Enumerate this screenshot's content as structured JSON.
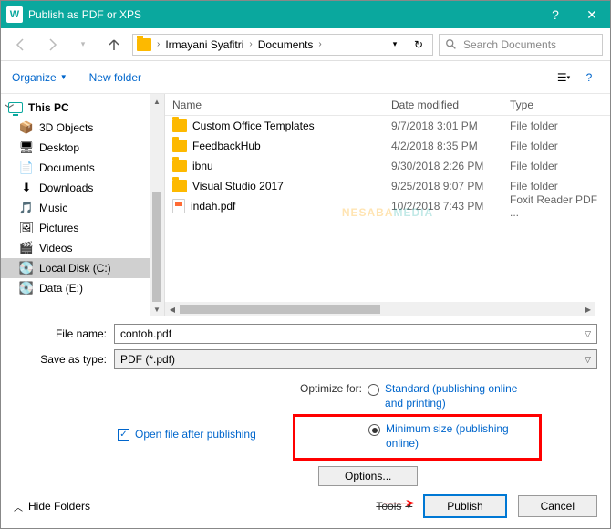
{
  "window": {
    "title": "Publish as PDF or XPS"
  },
  "nav": {
    "breadcrumb": [
      "Irmayani Syafitri",
      "Documents"
    ],
    "search_placeholder": "Search Documents"
  },
  "toolbar": {
    "organize": "Organize",
    "new_folder": "New folder"
  },
  "sidebar": {
    "root": "This PC",
    "items": [
      {
        "label": "3D Objects",
        "icon": "📦"
      },
      {
        "label": "Desktop",
        "icon": "🖥"
      },
      {
        "label": "Documents",
        "icon": "📄"
      },
      {
        "label": "Downloads",
        "icon": "⬇"
      },
      {
        "label": "Music",
        "icon": "🎵"
      },
      {
        "label": "Pictures",
        "icon": "🖼"
      },
      {
        "label": "Videos",
        "icon": "🎬"
      },
      {
        "label": "Local Disk (C:)",
        "icon": "💽",
        "selected": true
      },
      {
        "label": "Data (E:)",
        "icon": "💽"
      }
    ]
  },
  "columns": {
    "name": "Name",
    "date": "Date modified",
    "type": "Type"
  },
  "files": [
    {
      "name": "Custom Office Templates",
      "date": "9/7/2018 3:01 PM",
      "type": "File folder",
      "kind": "folder"
    },
    {
      "name": "FeedbackHub",
      "date": "4/2/2018 8:35 PM",
      "type": "File folder",
      "kind": "folder"
    },
    {
      "name": "ibnu",
      "date": "9/30/2018 2:26 PM",
      "type": "File folder",
      "kind": "folder"
    },
    {
      "name": "Visual Studio 2017",
      "date": "9/25/2018 9:07 PM",
      "type": "File folder",
      "kind": "folder"
    },
    {
      "name": "indah.pdf",
      "date": "10/2/2018 7:43 PM",
      "type": "Foxit Reader PDF ...",
      "kind": "pdf"
    }
  ],
  "form": {
    "file_name_label": "File name:",
    "file_name_value": "contoh.pdf",
    "save_type_label": "Save as type:",
    "save_type_value": "PDF (*.pdf)"
  },
  "options": {
    "open_after_label": "Open file after publishing",
    "open_after_checked": true,
    "optimize_label": "Optimize for:",
    "standard_label": "Standard (publishing online and printing)",
    "minimum_label": "Minimum size (publishing online)",
    "selected": "minimum",
    "options_btn": "Options..."
  },
  "footer": {
    "hide_folders": "Hide Folders",
    "tools": "Tools",
    "publish": "Publish",
    "cancel": "Cancel"
  },
  "watermark": {
    "a": "NESABA",
    "b": "MEDIA"
  }
}
